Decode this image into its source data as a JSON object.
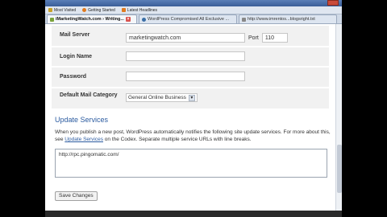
{
  "bookmarks": [
    {
      "label": "Most Visited",
      "color": "#c9a227"
    },
    {
      "label": "Getting Started",
      "color": "#e07a1f"
    },
    {
      "label": "Latest Headlines",
      "color": "#e07a1f"
    }
  ],
  "tabs": [
    {
      "label": "iMarketingWatch.com › Writing...",
      "active": true,
      "icon_color": "#7aa33a"
    },
    {
      "label": "WordPress Compromised All Exclusive ...",
      "active": false,
      "icon_color": "#3a6ea5"
    },
    {
      "label": "http://www.imrentos...blogsright.txt",
      "active": false,
      "icon_color": "#888888"
    }
  ],
  "form": {
    "mail_server_label": "Mail Server",
    "mail_server_value": "marketingwatch.com",
    "port_label": "Port",
    "port_value": "110",
    "login_label": "Login Name",
    "login_value": "",
    "password_label": "Password",
    "password_value": "",
    "category_label": "Default Mail Category",
    "category_value": "General Online Business"
  },
  "update_services": {
    "title": "Update Services",
    "desc_part1": "When you publish a new post, WordPress automatically notifies the following site update services. For more about this, see ",
    "link_text": "Update Services",
    "desc_part2": " on the Codex. Separate multiple service URLs with line breaks.",
    "ping_value": "http://rpc.pingomatic.com/"
  },
  "buttons": {
    "save_label": "Save Changes"
  }
}
